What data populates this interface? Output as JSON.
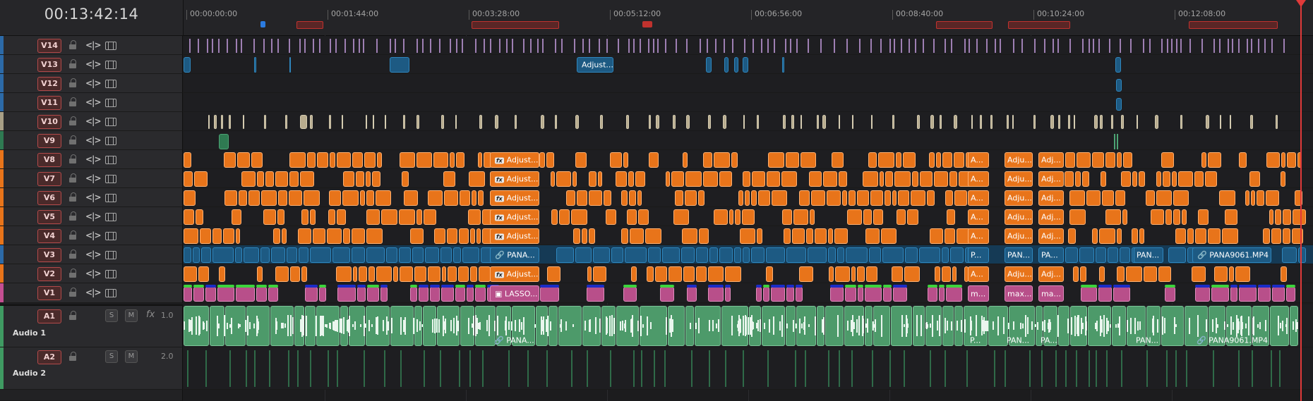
{
  "timeline": {
    "timecode": "00:13:42:14",
    "ruler_labels": [
      "00:00:00:00",
      "00:01:44:00",
      "00:03:28:00",
      "00:05:12:00",
      "00:06:56:00",
      "00:08:40:00",
      "00:10:24:00",
      "00:12:08:00"
    ]
  },
  "video_tracks": [
    {
      "id": "V14",
      "color": "#2c6aa8"
    },
    {
      "id": "V13",
      "color": "#2c6aa8"
    },
    {
      "id": "V12",
      "color": "#2c6aa8"
    },
    {
      "id": "V11",
      "color": "#2c6aa8"
    },
    {
      "id": "V10",
      "color": "#a89f86"
    },
    {
      "id": "V9",
      "color": "#2f7a52"
    },
    {
      "id": "V8",
      "color": "#e8741a"
    },
    {
      "id": "V7",
      "color": "#e8741a"
    },
    {
      "id": "V6",
      "color": "#e8741a"
    },
    {
      "id": "V5",
      "color": "#e8741a"
    },
    {
      "id": "V4",
      "color": "#e8741a"
    },
    {
      "id": "V3",
      "color": "#2c6aa8"
    },
    {
      "id": "V2",
      "color": "#e8741a"
    },
    {
      "id": "V1",
      "color": "#c44f92"
    }
  ],
  "audio_tracks": [
    {
      "id": "A1",
      "name": "Audio 1",
      "solo": "S",
      "mute": "M",
      "fx": "fx",
      "channels": "1.0",
      "color": "#3f9a62"
    },
    {
      "id": "A2",
      "name": "Audio 2",
      "solo": "S",
      "mute": "M",
      "channels": "2.0",
      "color": "#3f9a62"
    }
  ],
  "clip_labels": {
    "v13_adjust": "Adjust...",
    "v8_fx": "Adjust...",
    "v7_fx": "Adjust...",
    "v6_fx": "Adjust...",
    "v5_fx": "Adjust...",
    "v4_fx": "Adjust...",
    "v2_fx": "Adjust...",
    "v8_a": "A...",
    "v8_b": "Adju...",
    "v8_c": "Adj...",
    "v7_a": "A...",
    "v7_b": "Adju...",
    "v7_c": "Adj...",
    "v6_a": "A...",
    "v6_b": "Adju...",
    "v6_c": "Adj...",
    "v5_a": "A...",
    "v5_b": "Adju...",
    "v5_c": "Adj...",
    "v4_a": "A...",
    "v4_b": "Adju...",
    "v4_c": "Adj...",
    "v2_a": "A...",
    "v2_b": "Adju...",
    "v2_c": "Adj...",
    "v3_pana1": "PANA...",
    "v3_p": "P...",
    "v3_pan1": "PAN...",
    "v3_pa": "PA...",
    "v3_pan2": "PAN...",
    "v3_pana9061": "PANA9061.MP4",
    "v1_lasso": "LASSO...",
    "v1_m": "m...",
    "v1_max": "max...",
    "v1_ma": "ma...",
    "a1_pana1": "PANA...",
    "a1_p": "P...",
    "a1_pan1": "PAN...",
    "a1_pa": "PA...",
    "a1_pan2": "PAN...",
    "a1_pana9061": "PANA9061.MP4"
  },
  "colors": {
    "adjust_orange": "#e8741a",
    "clip_blue": "#1d5a83",
    "v1_pink": "#b84f8a",
    "audio_green": "#4d9a6a",
    "marker_red": "#c0322e",
    "marker_blue": "#2b7be0",
    "playhead": "#e03a3a"
  },
  "icons": [
    "lock-icon",
    "trim-icon",
    "film-icon",
    "link-icon",
    "image-icon",
    "fx-icon"
  ]
}
